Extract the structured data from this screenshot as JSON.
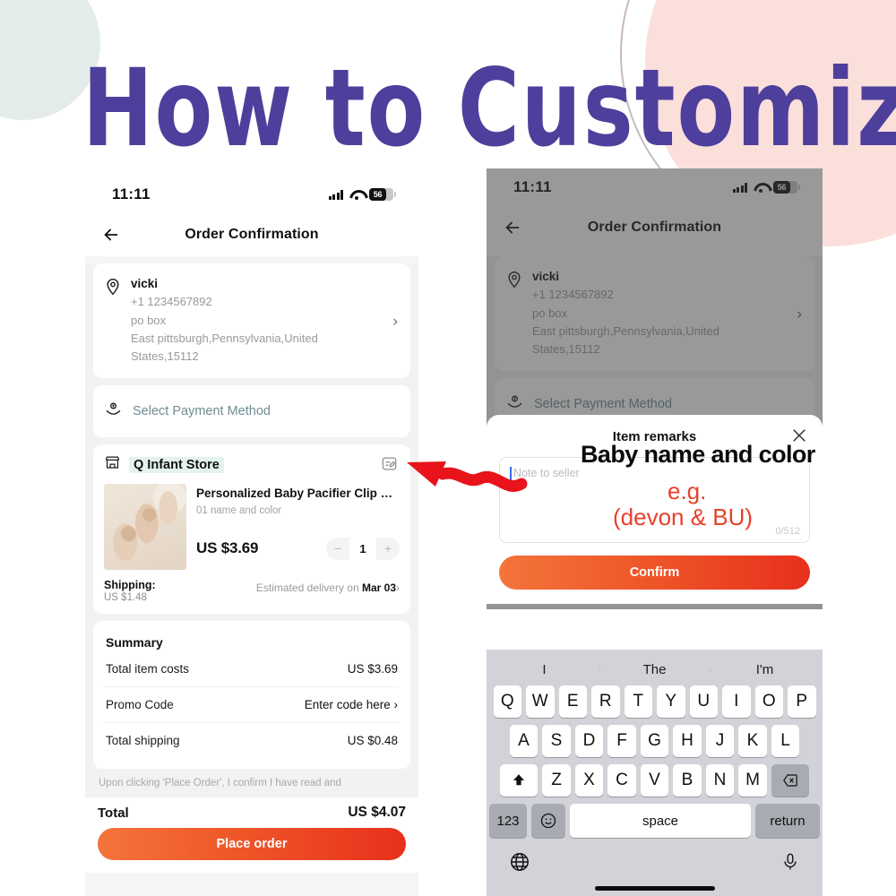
{
  "headline": "How to Customize",
  "theme": {
    "headline_color": "#4e3f9c",
    "accent_orange": "#ef5a2a",
    "accent_red": "#e8301c",
    "annotation_red": "#e8402b",
    "blob_pink": "#fbdfdb",
    "blob_mint": "#e3ecea",
    "store_highlight": "#e3f3ec"
  },
  "statusbar": {
    "time": "11:11",
    "battery_text": "56",
    "signal_icon": "cellular-signal-icon",
    "wifi_icon": "wifi-icon",
    "battery_icon": "battery-icon"
  },
  "nav": {
    "back_icon": "back-arrow-icon",
    "title": "Order Confirmation"
  },
  "address": {
    "pin_icon": "location-pin-icon",
    "name": "vicki",
    "phone": "+1 1234567892",
    "line1": "po box",
    "line2": "East pittsburgh,Pennsylvania,United",
    "line3": "States,15112",
    "chevron_icon": "chevron-right-icon"
  },
  "payment": {
    "icon": "payment-hand-icon",
    "label": "Select Payment Method"
  },
  "store": {
    "icon": "storefront-icon",
    "name": "Q Infant Store",
    "edit_icon": "edit-note-icon"
  },
  "item": {
    "thumbnail_alt": "wooden baby brush set",
    "title": "Personalized Baby Pacifier Clip Custo...",
    "variant": "01 name and color",
    "price": "US $3.69",
    "qty": "1",
    "minus_label": "−",
    "plus_label": "+",
    "shipping_label": "Shipping:",
    "shipping_cost": "US $1.48",
    "delivery_prefix": "Estimated delivery on ",
    "delivery_date": "Mar 03",
    "delivery_chevron": "›"
  },
  "summary": {
    "title": "Summary",
    "rows": [
      {
        "label": "Total item costs",
        "value": "US $3.69"
      },
      {
        "label": "Promo Code",
        "value": "Enter code here ›"
      },
      {
        "label": "Total shipping",
        "value": "US $0.48"
      }
    ],
    "disclaimer": "Upon clicking 'Place Order', I confirm I have read and"
  },
  "bottom": {
    "total_label": "Total",
    "total_value": "US $4.07",
    "cta_label": "Place order"
  },
  "modal": {
    "title": "Item remarks",
    "close_icon": "close-icon",
    "note_placeholder": "Note to seller",
    "char_counter": "0/512",
    "confirm_label": "Confirm"
  },
  "annotations": {
    "arrow_icon": "red-wavy-arrow-icon",
    "baby_name_color": "Baby name and color",
    "eg": "e.g.",
    "example": "(devon & BU)"
  },
  "keyboard": {
    "predictions": [
      "I",
      "The",
      "I'm"
    ],
    "row1": [
      "Q",
      "W",
      "E",
      "R",
      "T",
      "Y",
      "U",
      "I",
      "O",
      "P"
    ],
    "row2": [
      "A",
      "S",
      "D",
      "F",
      "G",
      "H",
      "J",
      "K",
      "L"
    ],
    "row3": [
      "Z",
      "X",
      "C",
      "V",
      "B",
      "N",
      "M"
    ],
    "shift_icon": "shift-up-icon",
    "backspace_icon": "backspace-icon",
    "numbers_label": "123",
    "emoji_icon": "emoji-smiley-icon",
    "space_label": "space",
    "return_label": "return",
    "globe_icon": "globe-icon",
    "mic_icon": "microphone-icon"
  }
}
